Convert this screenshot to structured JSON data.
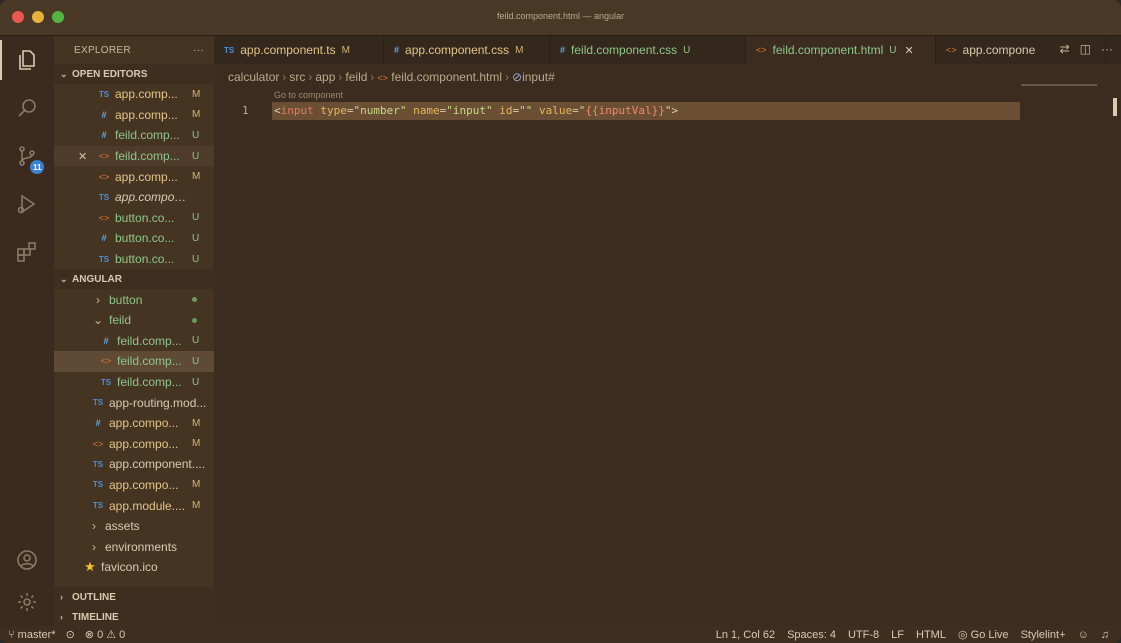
{
  "window": {
    "title": "feild.component.html — angular"
  },
  "activity_bar": {
    "items": [
      {
        "name": "explorer-icon"
      },
      {
        "name": "search-icon"
      },
      {
        "name": "source-control-icon",
        "badge": "11"
      },
      {
        "name": "run-debug-icon"
      },
      {
        "name": "extensions-icon"
      }
    ],
    "bottom": [
      {
        "name": "account-icon"
      },
      {
        "name": "settings-gear-icon"
      }
    ]
  },
  "sidebar": {
    "title": "EXPLORER",
    "more": "···",
    "open_editors": {
      "label": "OPEN EDITORS",
      "items": [
        {
          "icon": "TS",
          "type": "ts",
          "name": "app.comp...",
          "status": "M"
        },
        {
          "icon": "#",
          "type": "css",
          "name": "app.comp...",
          "status": "M"
        },
        {
          "icon": "#",
          "type": "css",
          "name": "feild.comp...",
          "status": "U"
        },
        {
          "icon": "<>",
          "type": "html",
          "name": "feild.comp...",
          "status": "U",
          "close": "✕"
        },
        {
          "icon": "<>",
          "type": "html",
          "name": "app.comp...",
          "status": "M"
        },
        {
          "icon": "TS",
          "type": "ts",
          "name": "app.component...",
          "status": ""
        },
        {
          "icon": "<>",
          "type": "html",
          "name": "button.co...",
          "status": "U"
        },
        {
          "icon": "#",
          "type": "css",
          "name": "button.co...",
          "status": "U"
        },
        {
          "icon": "TS",
          "type": "ts",
          "name": "button.co...",
          "status": "U"
        }
      ]
    },
    "angular": {
      "label": "ANGULAR",
      "items": [
        {
          "chev": ">",
          "name": "button",
          "status": "dot"
        },
        {
          "chev": "v",
          "name": "feild",
          "status": "dot"
        },
        {
          "icon": "#",
          "type": "css",
          "name": "feild.comp...",
          "status": "U"
        },
        {
          "icon": "<>",
          "type": "html",
          "name": "feild.comp...",
          "status": "U"
        },
        {
          "icon": "TS",
          "type": "ts",
          "name": "feild.comp...",
          "status": "U"
        },
        {
          "icon": "TS",
          "type": "ts",
          "name": "app-routing.mod...",
          "status": ""
        },
        {
          "icon": "#",
          "type": "css",
          "name": "app.compo...",
          "status": "M"
        },
        {
          "icon": "<>",
          "type": "html",
          "name": "app.compo...",
          "status": "M"
        },
        {
          "icon": "TS",
          "type": "ts",
          "name": "app.component....",
          "status": ""
        },
        {
          "icon": "TS",
          "type": "ts",
          "name": "app.compo...",
          "status": "M"
        },
        {
          "icon": "TS",
          "type": "ts",
          "name": "app.module....",
          "status": "M"
        },
        {
          "chev": ">",
          "name": "assets",
          "status": ""
        },
        {
          "chev": ">",
          "name": "environments",
          "status": ""
        },
        {
          "icon": "★",
          "type": "star",
          "name": "favicon.ico",
          "status": ""
        }
      ]
    },
    "outline": {
      "label": "OUTLINE"
    },
    "timeline": {
      "label": "TIMELINE"
    }
  },
  "tabs": [
    {
      "icon": "TS",
      "type": "ts",
      "label": "app.component.ts",
      "status": "M"
    },
    {
      "icon": "#",
      "type": "css",
      "label": "app.component.css",
      "status": "M"
    },
    {
      "icon": "#",
      "type": "css",
      "label": "feild.component.css",
      "status": "U"
    },
    {
      "icon": "<>",
      "type": "html",
      "label": "feild.component.html",
      "status": "U",
      "close": "✕"
    },
    {
      "icon": "<>",
      "type": "html",
      "label": "app.compone",
      "status": ""
    }
  ],
  "breadcrumb": {
    "parts": [
      "calculator",
      "src",
      "app",
      "feild"
    ],
    "file": "feild.component.html",
    "symbol": "input#"
  },
  "editor": {
    "codelens": "Go to component",
    "line_number": "1",
    "code": {
      "open": "<",
      "tag": "input",
      "attr1": " type",
      "eq1": "=",
      "val1": "\"number\"",
      "attr2": " name",
      "eq2": "=",
      "val2": "\"input\"",
      "attr3": " id",
      "eq3": "=",
      "val3": "\"\"",
      "attr4": " value",
      "eq4": "=",
      "val4a": "\"",
      "interp": "{{inputVal}}",
      "val4b": "\"",
      "close": ">"
    }
  },
  "statusbar": {
    "branch": "master*",
    "sync": "⊙",
    "errors": "⊗ 0",
    "warnings": "⚠ 0",
    "position": "Ln 1, Col 62",
    "spaces": "Spaces: 4",
    "encoding": "UTF-8",
    "eol": "LF",
    "language": "HTML",
    "golive": "Go Live",
    "stylelint": "Stylelint+"
  }
}
